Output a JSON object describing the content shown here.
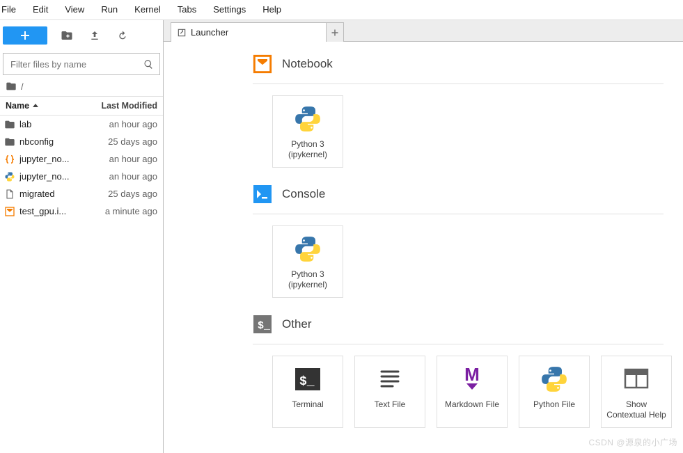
{
  "menu": [
    "File",
    "Edit",
    "View",
    "Run",
    "Kernel",
    "Tabs",
    "Settings",
    "Help"
  ],
  "sidebar": {
    "filter_placeholder": "Filter files by name",
    "breadcrumb_root": "/",
    "header_name": "Name",
    "header_modified": "Last Modified",
    "items": [
      {
        "icon": "folder",
        "name": "lab",
        "time": "an hour ago"
      },
      {
        "icon": "folder",
        "name": "nbconfig",
        "time": "25 days ago"
      },
      {
        "icon": "json",
        "name": "jupyter_no...",
        "time": "an hour ago"
      },
      {
        "icon": "python",
        "name": "jupyter_no...",
        "time": "an hour ago"
      },
      {
        "icon": "file",
        "name": "migrated",
        "time": "25 days ago"
      },
      {
        "icon": "notebook",
        "name": "test_gpu.i...",
        "time": "a minute ago"
      }
    ]
  },
  "tab": {
    "label": "Launcher"
  },
  "launcher": {
    "sections": [
      {
        "title": "Notebook",
        "icon": "notebook-section",
        "cards": [
          {
            "icon": "python-logo",
            "label": "Python 3\n(ipykernel)"
          }
        ]
      },
      {
        "title": "Console",
        "icon": "console-section",
        "cards": [
          {
            "icon": "python-logo",
            "label": "Python 3\n(ipykernel)"
          }
        ]
      },
      {
        "title": "Other",
        "icon": "other-section",
        "cards": [
          {
            "icon": "terminal",
            "label": "Terminal"
          },
          {
            "icon": "textfile",
            "label": "Text File"
          },
          {
            "icon": "markdown",
            "label": "Markdown File"
          },
          {
            "icon": "python-logo",
            "label": "Python File"
          },
          {
            "icon": "inspector",
            "label": "Show\nContextual Help"
          }
        ]
      }
    ]
  },
  "watermark": "CSDN @源泉的小广场"
}
